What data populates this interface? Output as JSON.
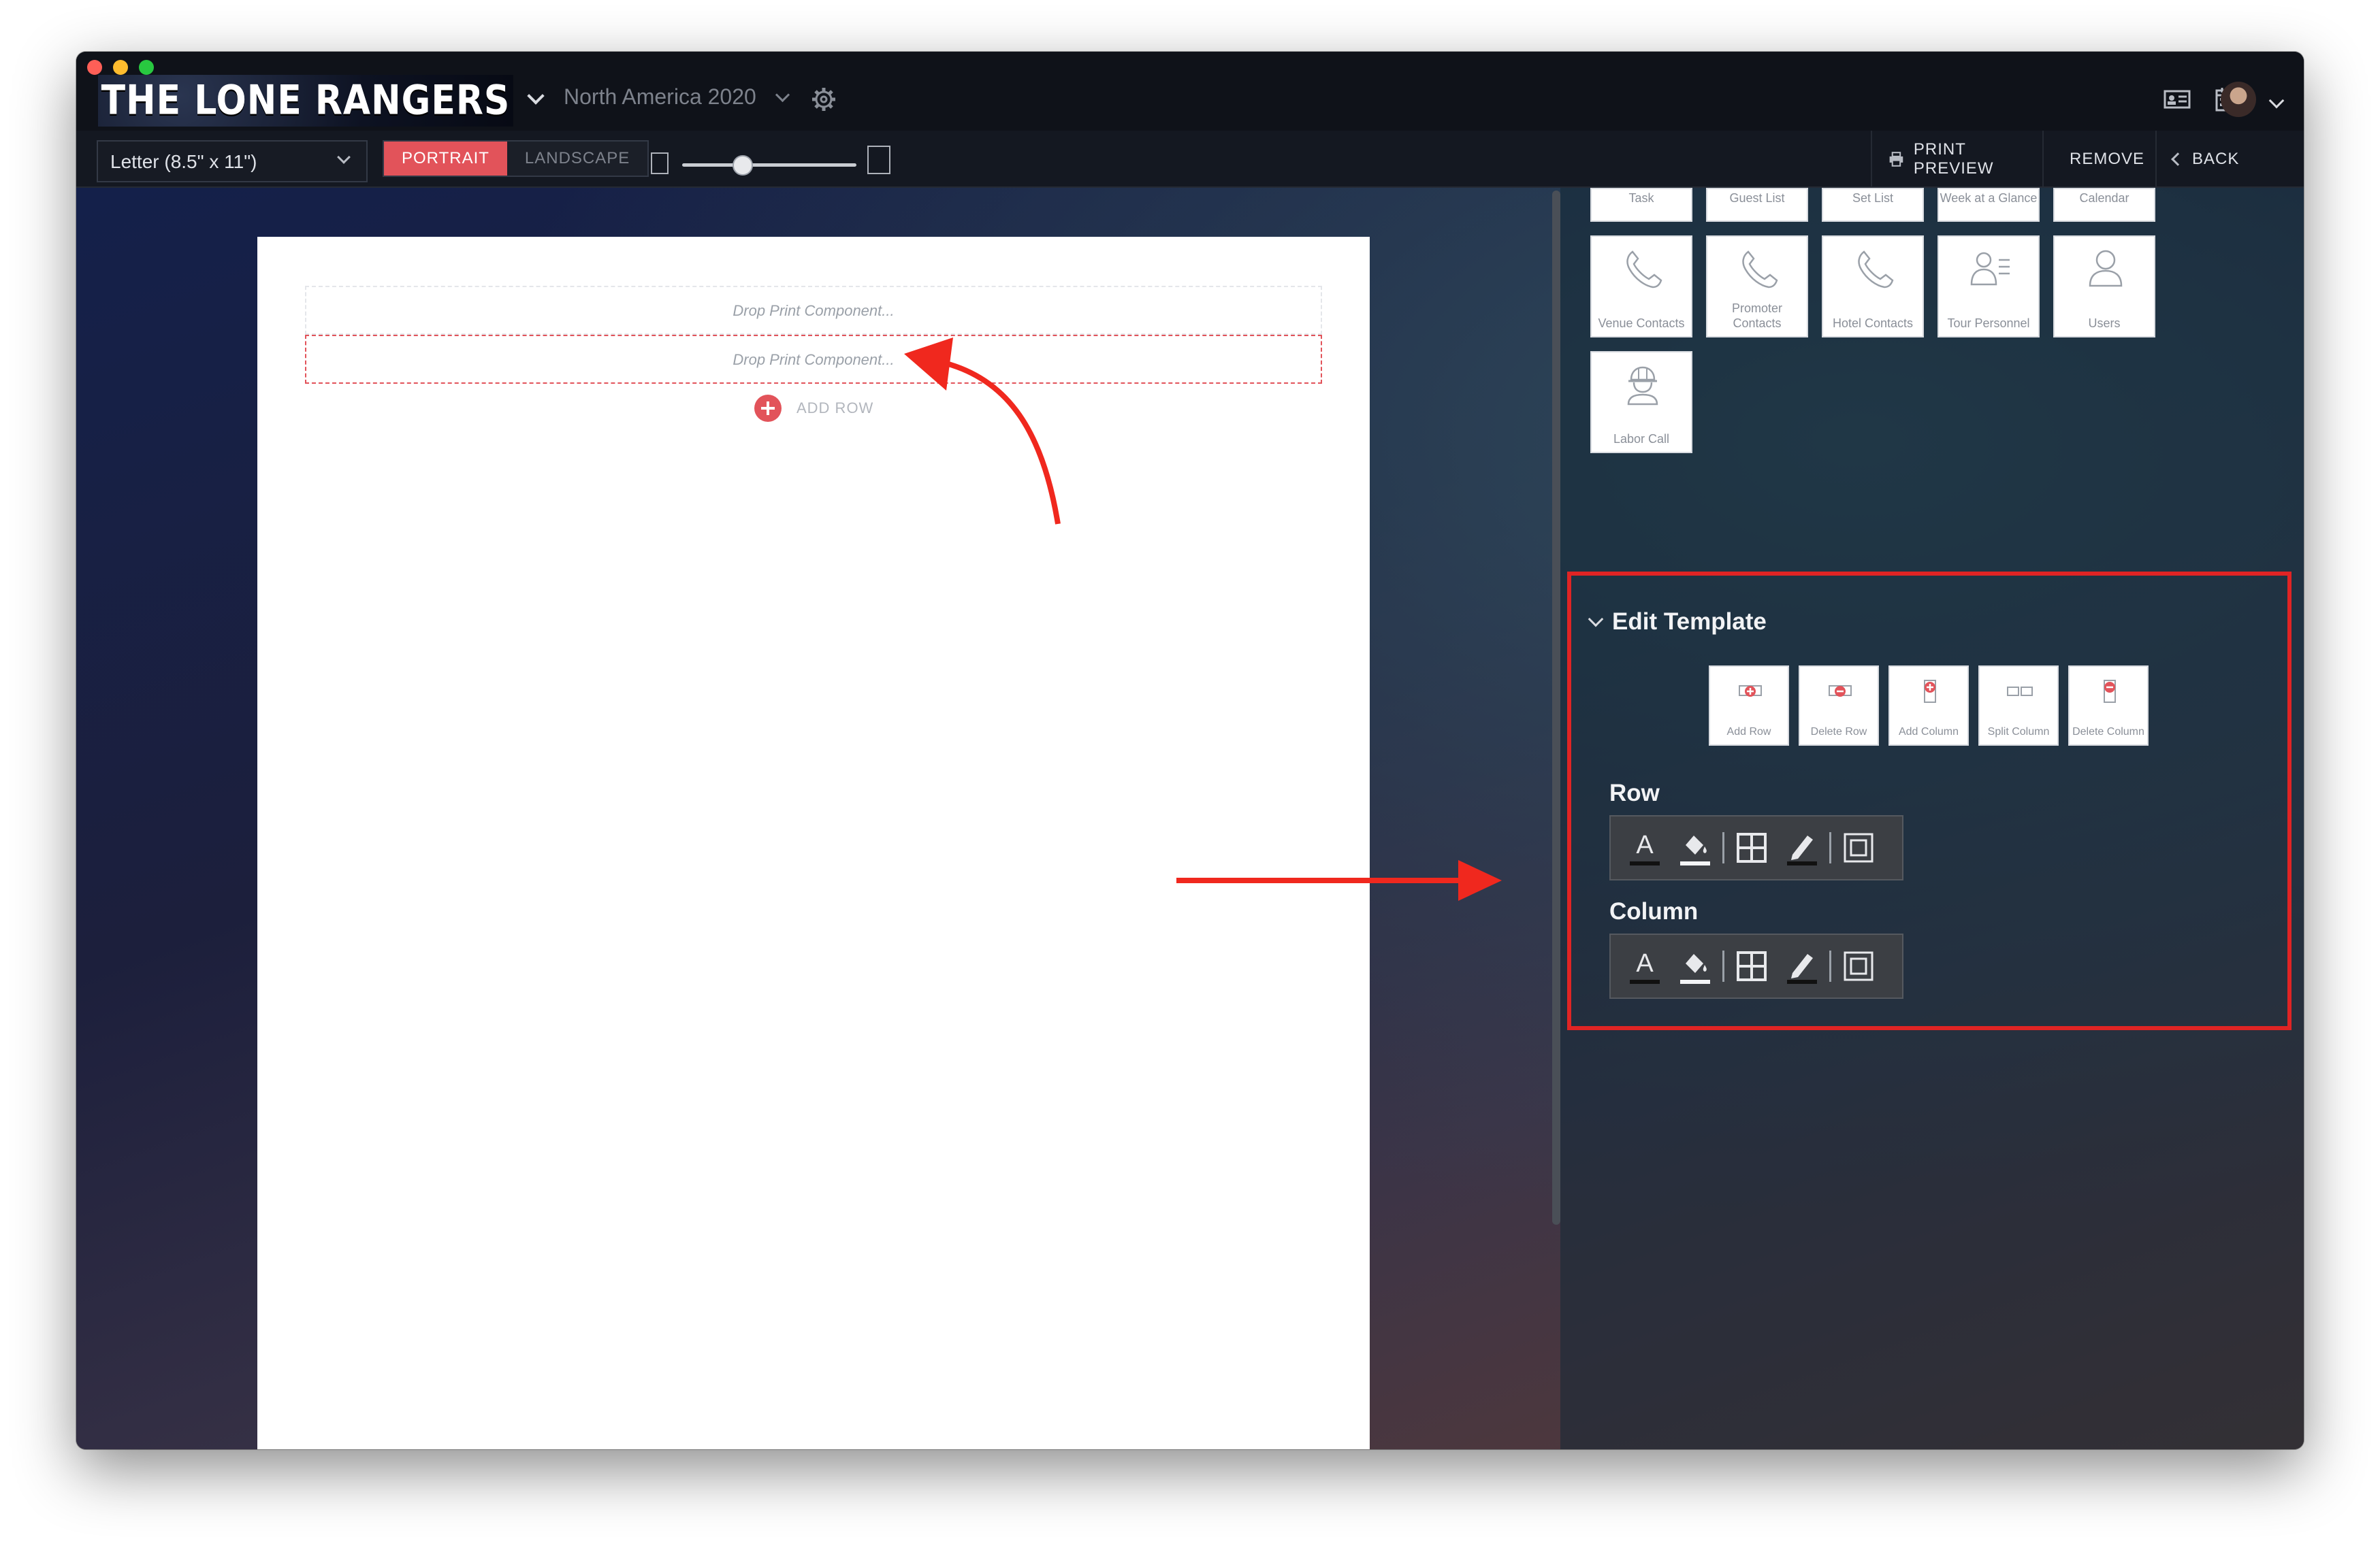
{
  "app": {
    "logo_text": "THE LONE RANGERS",
    "tour_name": "North America 2020"
  },
  "toolbar": {
    "paper_size": "Letter (8.5\" x 11\")",
    "orientation_portrait": "PORTRAIT",
    "orientation_landscape": "LANDSCAPE",
    "selected_orientation": "PORTRAIT",
    "zoom_level": 0.35,
    "print_preview_label": "PRINT PREVIEW",
    "remove_label": "REMOVE",
    "back_label": "BACK"
  },
  "canvas": {
    "drop_placeholder_1": "Drop Print Component...",
    "drop_placeholder_2": "Drop Print Component...",
    "add_row_label": "ADD ROW"
  },
  "components_partial": [
    {
      "label": "Task"
    },
    {
      "label": "Guest List"
    },
    {
      "label": "Set List"
    },
    {
      "label": "Week at a Glance"
    },
    {
      "label": "Calendar"
    }
  ],
  "components": [
    {
      "label": "Venue Contacts",
      "icon": "phone-icon"
    },
    {
      "label": "Promoter Contacts",
      "icon": "phone-icon"
    },
    {
      "label": "Hotel Contacts",
      "icon": "phone-icon"
    },
    {
      "label": "Tour Personnel",
      "icon": "personnel-icon"
    },
    {
      "label": "Users",
      "icon": "user-icon"
    },
    {
      "label": "Labor Call",
      "icon": "hardhat-icon"
    }
  ],
  "edit_template": {
    "title": "Edit Template",
    "buttons": [
      {
        "label": "Add Row",
        "icon": "add-row-icon"
      },
      {
        "label": "Delete Row",
        "icon": "delete-row-icon"
      },
      {
        "label": "Add Column",
        "icon": "add-column-icon"
      },
      {
        "label": "Split Column",
        "icon": "split-column-icon"
      },
      {
        "label": "Delete Column",
        "icon": "delete-column-icon"
      }
    ],
    "row_label": "Row",
    "column_label": "Column"
  },
  "colors": {
    "accent": "#e2535a",
    "highlight_box": "#e02424",
    "arrow": "#f0281e"
  }
}
